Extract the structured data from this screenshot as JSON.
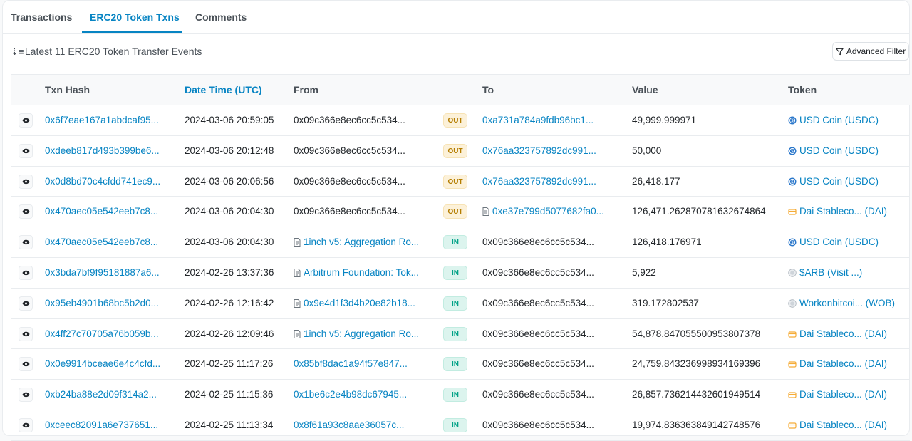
{
  "tabs": [
    {
      "label": "Transactions"
    },
    {
      "label": "ERC20 Token Txns"
    },
    {
      "label": "Comments"
    }
  ],
  "summary": "Latest 11 ERC20 Token Transfer Events",
  "filter_button": "Advanced Filter",
  "headers": {
    "txn_hash": "Txn Hash",
    "date_time": "Date Time (UTC)",
    "from": "From",
    "to": "To",
    "value": "Value",
    "token": "Token"
  },
  "rows": [
    {
      "hash": "0x6f7eae167a1abdcaf95...",
      "date": "2024-03-06 20:59:05",
      "from": "0x09c366e8ec6cc5c534...",
      "from_contract": false,
      "direction": "OUT",
      "to": "0xa731a784a9fdb96bc1...",
      "to_contract": false,
      "value": "49,999.999971",
      "token": "USD Coin (USDC)",
      "token_icon": "usdc-icon"
    },
    {
      "hash": "0xdeeb817d493b399be6...",
      "date": "2024-03-06 20:12:48",
      "from": "0x09c366e8ec6cc5c534...",
      "from_contract": false,
      "direction": "OUT",
      "to": "0x76aa323757892dc991...",
      "to_contract": false,
      "value": "50,000",
      "token": "USD Coin (USDC)",
      "token_icon": "usdc-icon"
    },
    {
      "hash": "0x0d8bd70c4cfdd741ec9...",
      "date": "2024-03-06 20:06:56",
      "from": "0x09c366e8ec6cc5c534...",
      "from_contract": false,
      "direction": "OUT",
      "to": "0x76aa323757892dc991...",
      "to_contract": false,
      "value": "26,418.177",
      "token": "USD Coin (USDC)",
      "token_icon": "usdc-icon"
    },
    {
      "hash": "0x470aec05e542eeb7c8...",
      "date": "2024-03-06 20:04:30",
      "from": "0x09c366e8ec6cc5c534...",
      "from_contract": false,
      "direction": "OUT",
      "to": "0xe37e799d5077682fa0...",
      "to_contract": true,
      "value": "126,471.262870781632674864",
      "token": "Dai Stableco... (DAI)",
      "token_icon": "dai-icon"
    },
    {
      "hash": "0x470aec05e542eeb7c8...",
      "date": "2024-03-06 20:04:30",
      "from": "1inch v5: Aggregation Ro...",
      "from_contract": true,
      "direction": "IN",
      "to": "0x09c366e8ec6cc5c534...",
      "to_contract": false,
      "value": "126,418.176971",
      "token": "USD Coin (USDC)",
      "token_icon": "usdc-icon"
    },
    {
      "hash": "0x3bda7bf9f95181887a6...",
      "date": "2024-02-26 13:37:36",
      "from": "Arbitrum Foundation: Tok...",
      "from_contract": true,
      "direction": "IN",
      "to": "0x09c366e8ec6cc5c534...",
      "to_contract": false,
      "value": "5,922",
      "token": "$ARB (Visit ...)",
      "token_icon": "generic-token-icon"
    },
    {
      "hash": "0x95eb4901b68bc5b2d0...",
      "date": "2024-02-26 12:16:42",
      "from": "0x9e4d1f3d4b20e82b18...",
      "from_contract": true,
      "direction": "IN",
      "to": "0x09c366e8ec6cc5c534...",
      "to_contract": false,
      "value": "319.172802537",
      "token": "Workonbitcoi... (WOB)",
      "token_icon": "generic-token-icon"
    },
    {
      "hash": "0x4ff27c70705a76b059b...",
      "date": "2024-02-26 12:09:46",
      "from": "1inch v5: Aggregation Ro...",
      "from_contract": true,
      "direction": "IN",
      "to": "0x09c366e8ec6cc5c534...",
      "to_contract": false,
      "value": "54,878.847055500953807378",
      "token": "Dai Stableco... (DAI)",
      "token_icon": "dai-icon"
    },
    {
      "hash": "0x0e9914bceae6e4c4cfd...",
      "date": "2024-02-25 11:17:26",
      "from": "0x85bf8dac1a94f57e847...",
      "from_contract": false,
      "direction": "IN",
      "to": "0x09c366e8ec6cc5c534...",
      "to_contract": false,
      "value": "24,759.843236998934169396",
      "token": "Dai Stableco... (DAI)",
      "token_icon": "dai-icon"
    },
    {
      "hash": "0xb24ba88e2d09f314a2...",
      "date": "2024-02-25 11:15:36",
      "from": "0x1be6c2e4b98dc67945...",
      "from_contract": false,
      "direction": "IN",
      "to": "0x09c366e8ec6cc5c534...",
      "to_contract": false,
      "value": "26,857.736214432601949514",
      "token": "Dai Stableco... (DAI)",
      "token_icon": "dai-icon"
    },
    {
      "hash": "0xceec82091a6e737651...",
      "date": "2024-02-25 11:13:34",
      "from": "0x8f61a93c8aae36057c...",
      "from_contract": false,
      "direction": "IN",
      "to": "0x09c366e8ec6cc5c534...",
      "to_contract": false,
      "value": "19,974.836363849142748576",
      "token": "Dai Stableco... (DAI)",
      "token_icon": "dai-icon"
    }
  ],
  "colors": {
    "link": "#0784c3",
    "out_badge_bg": "#fcf1d9",
    "out_badge_text": "#b47d00",
    "in_badge_bg": "#dcf4ee",
    "in_badge_text": "#00a186"
  }
}
